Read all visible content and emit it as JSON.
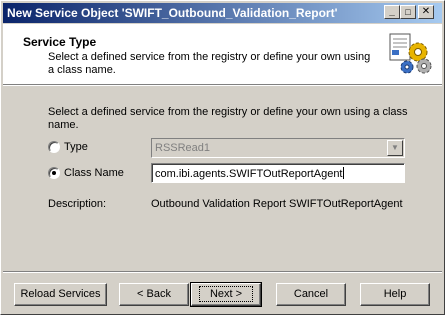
{
  "window": {
    "title": "New Service Object 'SWIFT_Outbound_Validation_Report'",
    "controls": {
      "minimize": "_",
      "maximize": "□",
      "close": "✕"
    }
  },
  "header": {
    "title": "Service Type",
    "subtitle": "Select a defined service from the registry or define your own using a class name.",
    "icon": "service-gears-icon"
  },
  "main": {
    "intro": "Select a defined service from the registry or define your own using a class name.",
    "type_label": "Type",
    "type_value": "RSSRead1",
    "class_name_label": "Class Name",
    "class_name_value": "com.ibi.agents.SWIFTOutReportAgent",
    "description_label": "Description:",
    "description_value": "Outbound Validation Report SWIFTOutReportAgent",
    "selected_option": "class_name"
  },
  "buttons": {
    "reload": "Reload Services",
    "back": "< Back",
    "next": "Next >",
    "cancel": "Cancel",
    "help": "Help"
  }
}
